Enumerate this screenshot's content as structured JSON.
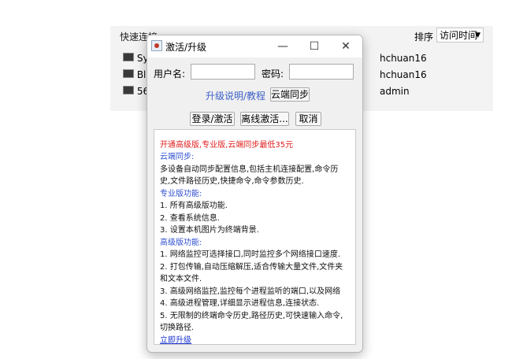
{
  "background": {
    "quick_connect": "快速连接",
    "sort_label": "排序",
    "sort_value": "访问时间",
    "rows": [
      {
        "name": "Sy",
        "user": "hchuan16"
      },
      {
        "name": "Bl",
        "user": "hchuan16"
      },
      {
        "name": "56",
        "user": "admin"
      }
    ]
  },
  "dialog": {
    "title": "激活/升级",
    "username_label": "用户名:",
    "username_value": "",
    "password_label": "密码:",
    "password_value": "",
    "upgrade_info_link": "升级说明/教程",
    "cloud_sync_button": "云端同步",
    "login_button": "登录/激活",
    "offline_button": "离线激活...",
    "cancel_button": "取消",
    "info": {
      "promo": "开通高级版,专业版,云端同步最低35元",
      "cloud_heading": "云端同步:",
      "cloud_line1": "多设备自动同步配置信息,包括主机连接配置,命令历",
      "cloud_line2": "史,文件路径历史,快捷命令,命令参数历史.",
      "pro_heading": "专业版功能:",
      "pro_items": [
        "1. 所有高级版功能.",
        "2. 查看系统信息.",
        "3. 设置本机图片为终端背景."
      ],
      "adv_heading": "高级版功能:",
      "adv_lines": [
        "1. 网络监控可选择接口,同时监控多个网络接口速度.",
        "2. 打包传输,自动压缩解压,适合传输大量文件,文件夹",
        "和文本文件.",
        "3. 高级网络监控,监控每个进程监听的端口,以及网络",
        "4. 高级进程管理,详细显示进程信息,连接状态.",
        "5. 无限制的终端命令历史,路径历史,可快速输入命令,",
        "切换路径."
      ],
      "upgrade_now": "立即升级"
    }
  }
}
